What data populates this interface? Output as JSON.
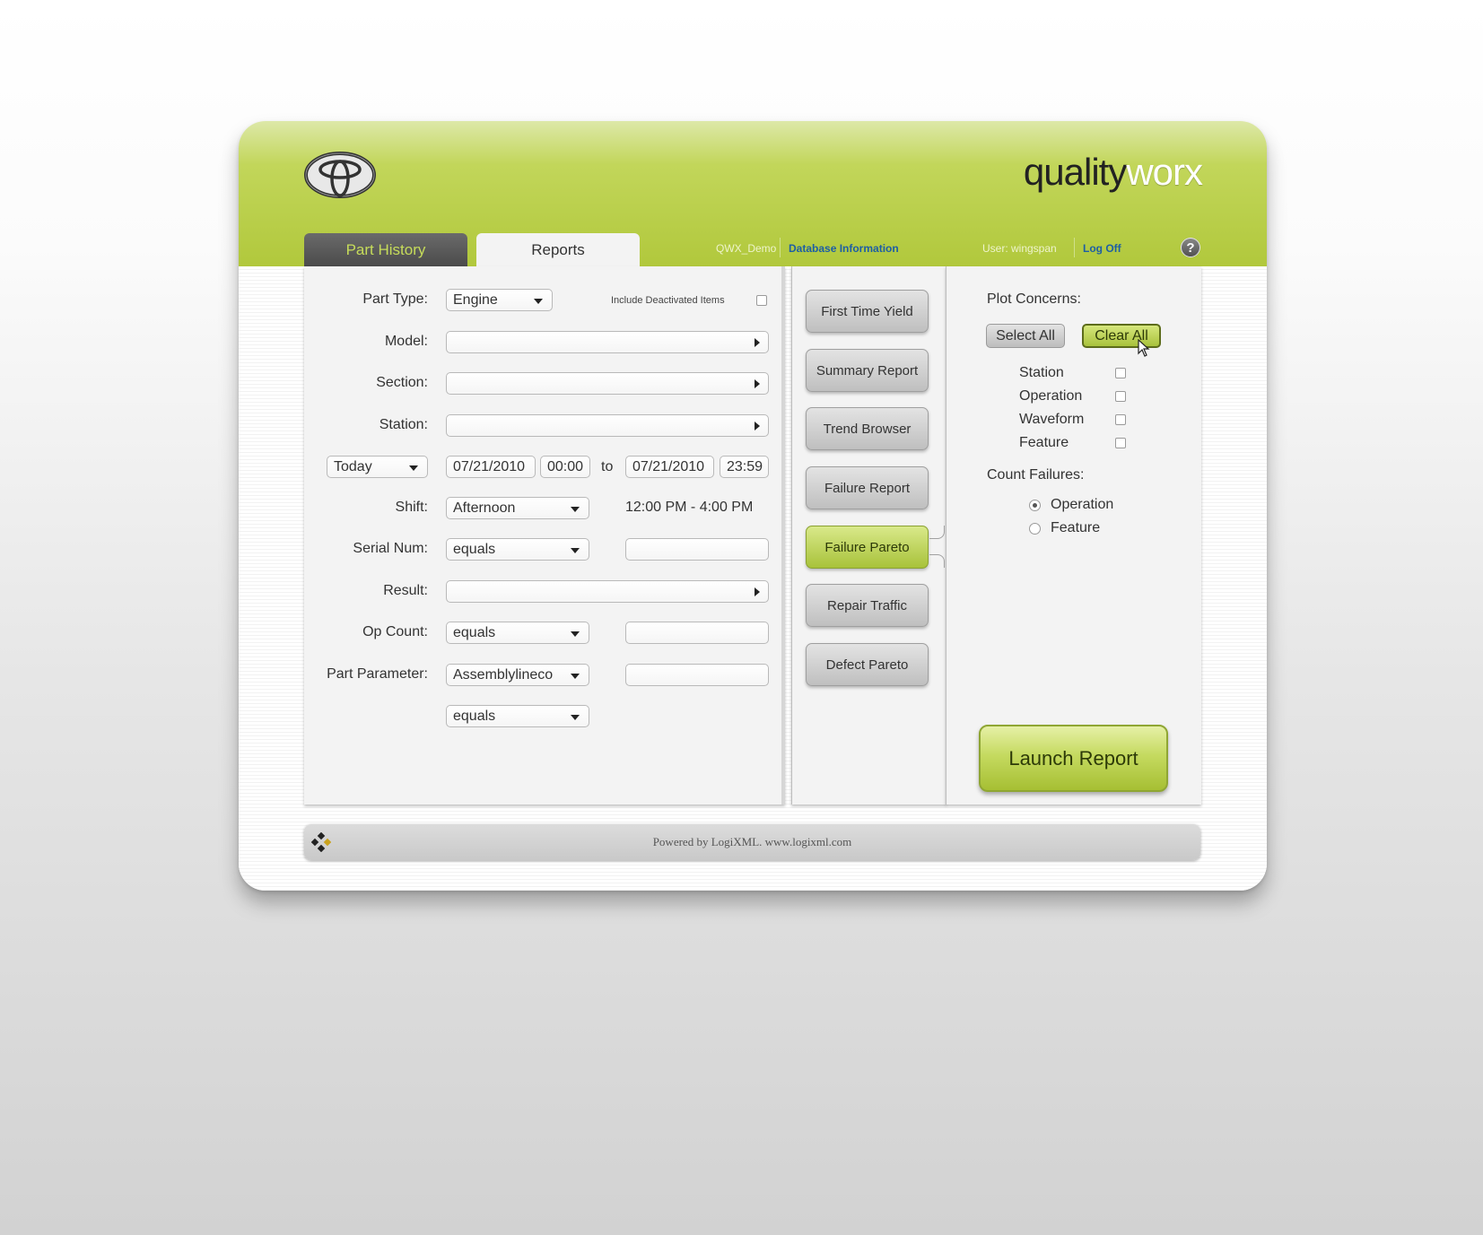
{
  "brand": {
    "part1": "quality",
    "part2": "worx"
  },
  "tabs": [
    {
      "label": "Part History",
      "active": false
    },
    {
      "label": "Reports",
      "active": true
    }
  ],
  "header_links": {
    "database": "QWX_Demo",
    "db_info": "Database Information",
    "user": "User:  wingspan",
    "logoff": "Log Off",
    "help": "?"
  },
  "form": {
    "part_type": {
      "label": "Part Type:",
      "value": "Engine"
    },
    "include_deactivated": {
      "label": "Include Deactivated Items",
      "checked": false
    },
    "model": {
      "label": "Model:",
      "value": ""
    },
    "section": {
      "label": "Section:",
      "value": ""
    },
    "station": {
      "label": "Station:",
      "value": ""
    },
    "date_range": {
      "preset": "Today",
      "from_date": "07/21/2010",
      "from_time": "00:00",
      "to_label": "to",
      "to_date": "07/21/2010",
      "to_time": "23:59"
    },
    "shift": {
      "label": "Shift:",
      "value": "Afternoon",
      "time_range": "12:00 PM - 4:00 PM"
    },
    "serial_num": {
      "label": "Serial Num:",
      "operator": "equals",
      "value": ""
    },
    "result": {
      "label": "Result:",
      "value": ""
    },
    "op_count": {
      "label": "Op Count:",
      "operator": "equals",
      "value": ""
    },
    "part_parameter": {
      "label": "Part Parameter:",
      "parameter": "Assemblylineco",
      "value": "",
      "operator": "equals"
    }
  },
  "reports": [
    {
      "label": "First Time Yield",
      "active": false
    },
    {
      "label": "Summary Report",
      "active": false
    },
    {
      "label": "Trend Browser",
      "active": false
    },
    {
      "label": "Failure Report",
      "active": false
    },
    {
      "label": "Failure Pareto",
      "active": true
    },
    {
      "label": "Repair Traffic",
      "active": false
    },
    {
      "label": "Defect Pareto",
      "active": false
    }
  ],
  "options": {
    "plot_concerns_label": "Plot Concerns:",
    "select_all": "Select All",
    "clear_all": "Clear All",
    "concerns": [
      {
        "label": "Station",
        "checked": false
      },
      {
        "label": "Operation",
        "checked": false
      },
      {
        "label": "Waveform",
        "checked": false
      },
      {
        "label": "Feature",
        "checked": false
      }
    ],
    "count_failures_label": "Count Failures:",
    "count_failures": [
      {
        "label": "Operation",
        "selected": true
      },
      {
        "label": "Feature",
        "selected": false
      }
    ]
  },
  "launch_label": "Launch Report",
  "footer_text": "Powered by LogiXML.  www.logixml.com",
  "colors": {
    "brand_green": "#b1c83c",
    "tab_dark": "#4b4b4b",
    "link_blue": "#1d5ea4"
  }
}
